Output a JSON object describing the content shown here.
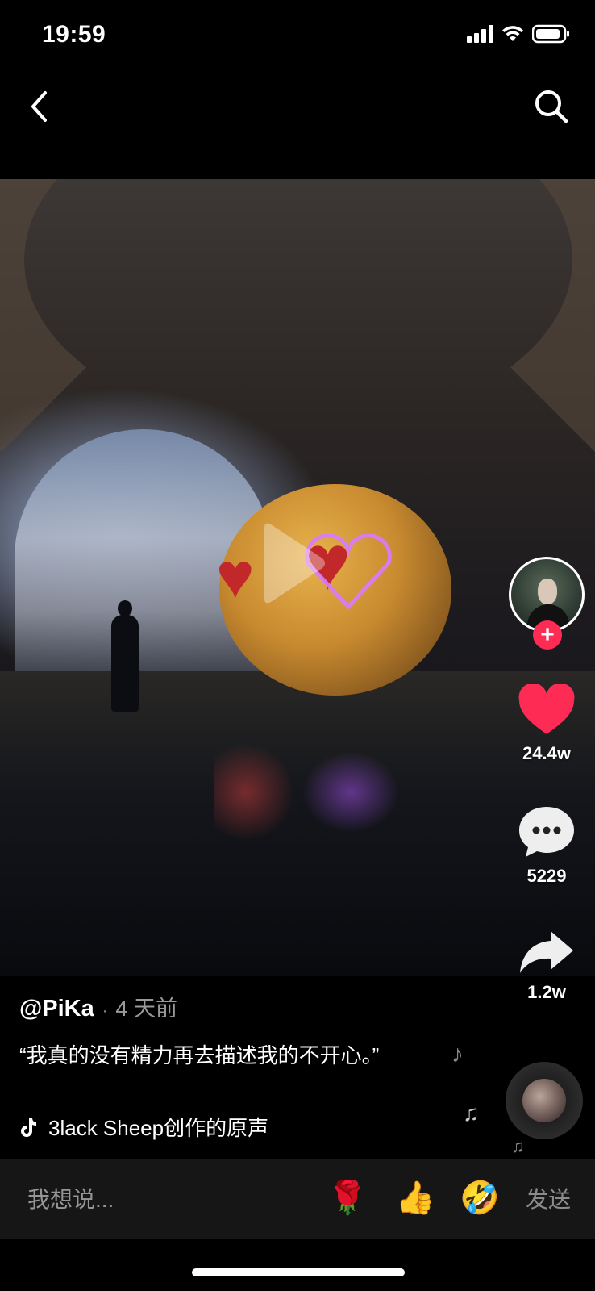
{
  "status_bar": {
    "time": "19:59",
    "icons": [
      "signal-icon",
      "wifi-icon",
      "battery-icon"
    ]
  },
  "top_nav": {
    "icons": [
      "back-icon",
      "search-icon"
    ]
  },
  "video": {
    "icons": [
      "play-icon"
    ]
  },
  "right_rail": {
    "follow_label": "+",
    "likes": "24.4w",
    "comments": "5229",
    "shares": "1.2w",
    "accent_color": "#fe2c55"
  },
  "caption": {
    "author": "@PiKa",
    "separator": "·",
    "time_ago": "4 天前",
    "description": "“我真的没有精力再去描述我的不开心。”",
    "music": "3lack Sheep创作的原声"
  },
  "input_bar": {
    "placeholder": "我想说...",
    "emojis": [
      "🌹",
      "👍",
      "🤣"
    ],
    "send_label": "发送"
  }
}
